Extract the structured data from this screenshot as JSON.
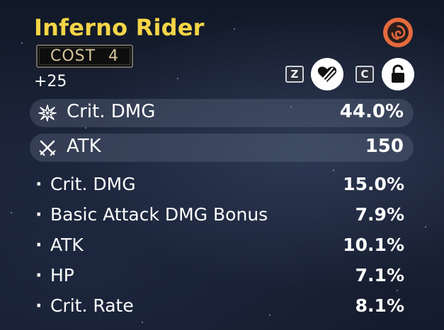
{
  "echo": {
    "name": "Inferno Rider",
    "cost_label": "COST 4",
    "level": "+25",
    "sonata_icon": "sonata-swirl-icon",
    "accent_color": "#f4d547",
    "sonata_color": "#e46a3e"
  },
  "controls": {
    "discard": {
      "key": "Z",
      "icon": "heart-slash-icon"
    },
    "lock": {
      "key": "C",
      "icon": "unlocked-padlock-icon"
    }
  },
  "main_stats": [
    {
      "label": "Crit. DMG",
      "value": "44.0%",
      "icon": "crit-dmg-icon"
    },
    {
      "label": "ATK",
      "value": "150",
      "icon": "atk-swords-icon"
    }
  ],
  "sub_stats": [
    {
      "bullet": "·",
      "label": "Crit. DMG",
      "value": "15.0%"
    },
    {
      "bullet": "·",
      "label": "Basic Attack DMG Bonus",
      "value": "7.9%"
    },
    {
      "bullet": "·",
      "label": "ATK",
      "value": "10.1%"
    },
    {
      "bullet": "·",
      "label": "HP",
      "value": "7.1%"
    },
    {
      "bullet": "·",
      "label": "Crit. Rate",
      "value": "8.1%"
    }
  ]
}
